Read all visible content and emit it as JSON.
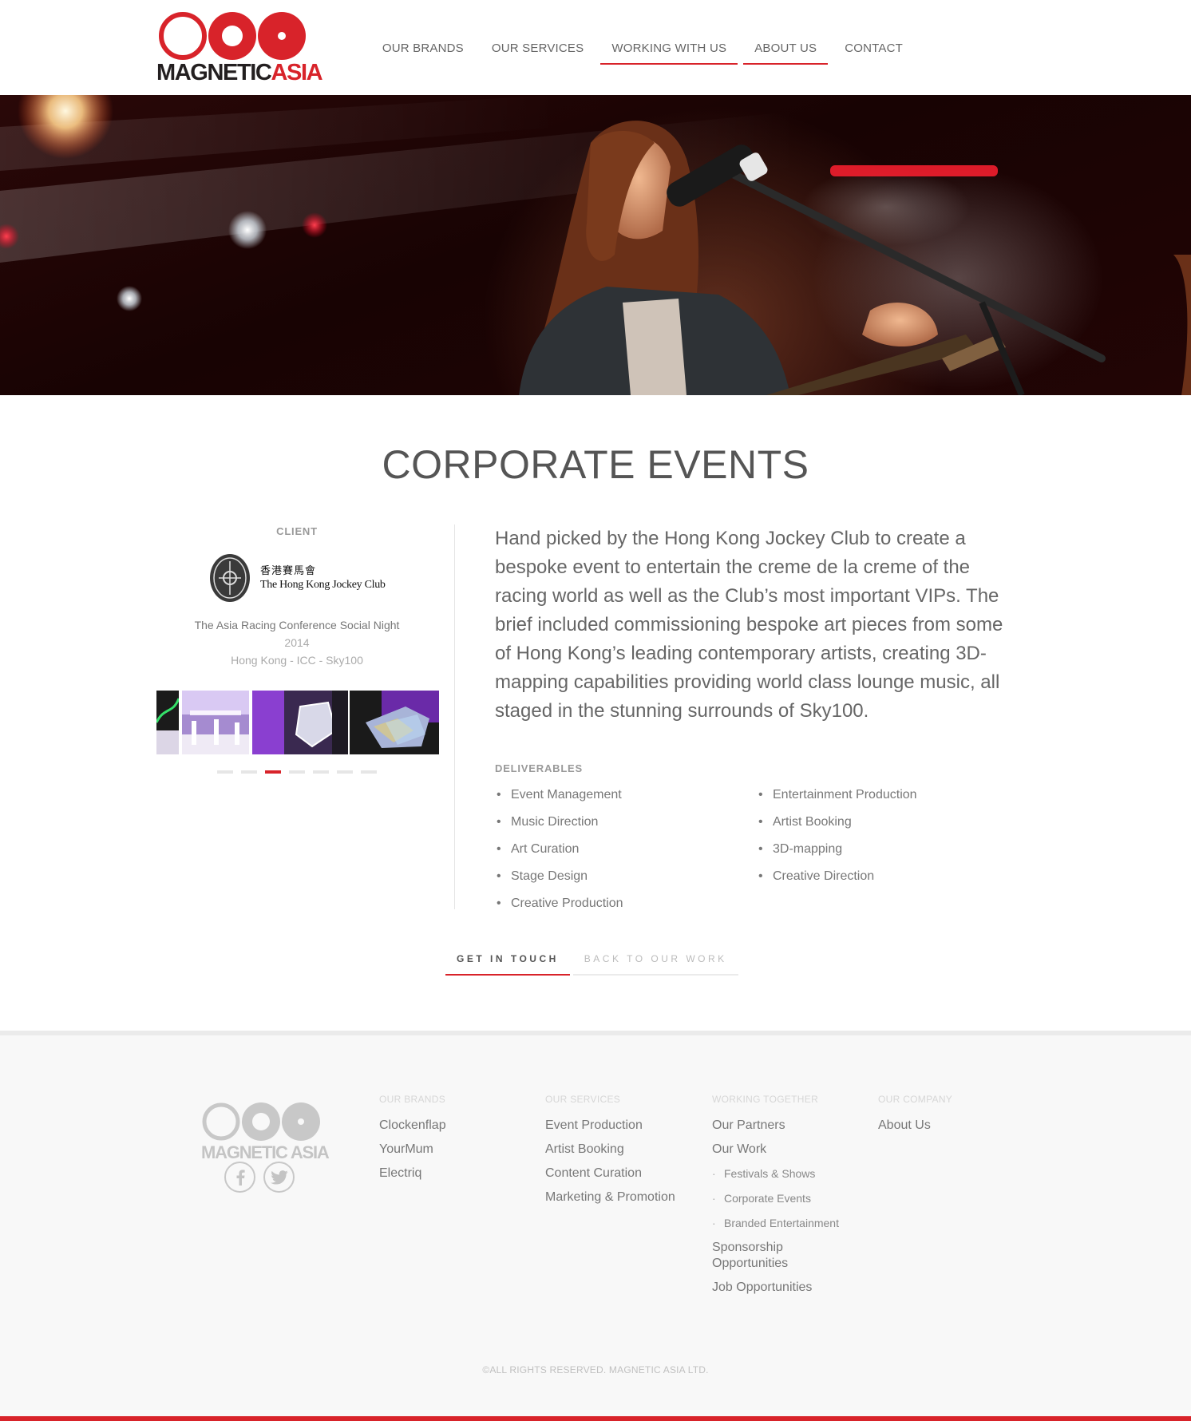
{
  "header": {
    "logo_text_main": "MAGNETIC",
    "logo_text_accent": "ASIA",
    "nav": [
      {
        "label": "OUR BRANDS",
        "active": false
      },
      {
        "label": "OUR SERVICES",
        "active": false
      },
      {
        "label": "WORKING WITH US",
        "active": true
      },
      {
        "label": "ABOUT US",
        "active": true
      },
      {
        "label": "CONTACT",
        "active": false
      }
    ]
  },
  "page": {
    "title": "CORPORATE EVENTS"
  },
  "client": {
    "label": "CLIENT",
    "logo_cn": "香港賽馬會",
    "logo_en": "The Hong Kong Jockey Club",
    "event_name": "The Asia Racing Conference Social Night",
    "year": "2014",
    "location": "Hong Kong - ICC - Sky100",
    "gallery_dots": 7,
    "gallery_active_dot": 3
  },
  "description": "Hand picked by the Hong Kong Jockey Club to create a bespoke event to entertain the creme de la creme of the racing world as well as the Club’s most important VIPs. The brief included commissioning bespoke art pieces from some of Hong Kong’s leading contemporary artists, creating 3D-mapping capabilities providing world class lounge music, all staged in the stunning surrounds of Sky100.",
  "deliverables": {
    "label": "DELIVERABLES",
    "col1": [
      "Event Management",
      "Music Direction",
      "Art Curation",
      "Stage Design",
      "Creative Production"
    ],
    "col2": [
      "Entertainment Production",
      "Artist Booking",
      "3D-mapping",
      "Creative Direction"
    ]
  },
  "cta": {
    "get_in_touch": "GET IN TOUCH",
    "back_to_work": "BACK TO OUR WORK"
  },
  "footer": {
    "logo_text": "MAGNETIC ASIA",
    "social": [
      "facebook-icon",
      "twitter-icon"
    ],
    "columns": [
      {
        "heading": "OUR BRANDS",
        "links": [
          "Clockenflap",
          "YourMum",
          "Electriq"
        ]
      },
      {
        "heading": "OUR SERVICES",
        "links": [
          "Event Production",
          "Artist Booking",
          "Content Curation",
          "Marketing & Promotion"
        ]
      },
      {
        "heading": "WORKING TOGETHER",
        "links": [
          "Our Partners",
          "Our Work"
        ],
        "sub_links": [
          "Festivals & Shows",
          "Corporate Events",
          "Branded Entertainment"
        ],
        "links_after": [
          "Sponsorship Opportunities",
          "Job Opportunities"
        ]
      },
      {
        "heading": "OUR COMPANY",
        "links": [
          "About Us"
        ]
      }
    ],
    "copyright": "©ALL RIGHTS RESERVED. MAGNETIC ASIA LTD."
  },
  "colors": {
    "accent": "#d8232a",
    "text": "#555555",
    "footer_bg": "#f8f8f8"
  }
}
